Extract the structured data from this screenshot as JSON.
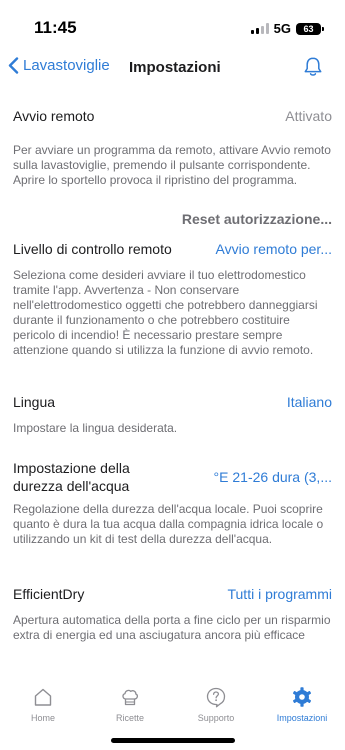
{
  "status_bar": {
    "time": "11:45",
    "network": "5G",
    "battery": "63"
  },
  "nav": {
    "back_label": "Lavastoviglie",
    "title": "Impostazioni"
  },
  "settings": [
    {
      "title": "Avvio remoto",
      "value": "Attivato",
      "description": "Per avviare un programma da remoto, attivare Avvio remoto sulla lavastoviglie, premendo il pulsante corrispondente. Aprire lo sportello provoca il ripristino del programma.",
      "action": "Reset autorizzazione..."
    },
    {
      "title": "Livello di controllo remoto",
      "value": "Avvio remoto per...",
      "description": "Seleziona come desideri avviare il tuo elettrodomestico tramite l'app. Avvertenza - Non conservare nell'elettrodomestico oggetti che potrebbero danneggiarsi durante il funzionamento o che potrebbero costituire pericolo di incendio! È necessario prestare sempre attenzione quando si utilizza la funzione di avvio remoto."
    },
    {
      "title": "Lingua",
      "value": "Italiano",
      "description": "Impostare la lingua desiderata."
    },
    {
      "title": "Impostazione della durezza dell'acqua",
      "value": "°E 21-26 dura (3,...",
      "description": "Regolazione della durezza dell'acqua locale. Puoi scoprire quanto è dura la tua acqua dalla compagnia idrica locale o utilizzando un kit di test della durezza dell'acqua."
    },
    {
      "title": "EfficientDry",
      "value": "Tutti i programmi",
      "description": "Apertura automatica della porta a fine ciclo per un risparmio extra di energia ed una asciugatura ancora più efficace"
    }
  ],
  "tabs": [
    {
      "label": "Home",
      "icon": "house-icon"
    },
    {
      "label": "Ricette",
      "icon": "chef-hat-icon"
    },
    {
      "label": "Supporto",
      "icon": "help-bubble-icon"
    },
    {
      "label": "Impostazioni",
      "icon": "gear-icon",
      "active": true
    }
  ],
  "colors": {
    "accent": "#2f7cd6",
    "secondary_text": "#6e6e73",
    "value_gray": "#8e8e93"
  }
}
